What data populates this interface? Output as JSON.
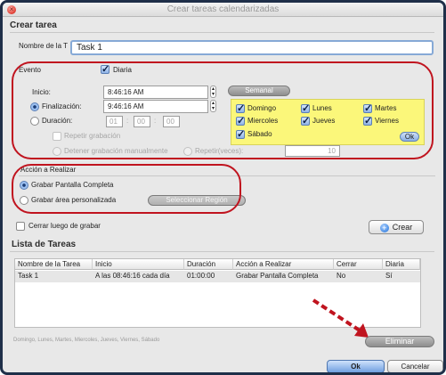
{
  "window": {
    "title": "Crear tareas calendarizadas"
  },
  "crear_tarea": {
    "section_title": "Crear tarea",
    "name_label": "Nombre de la T",
    "name_value": "Task 1"
  },
  "evento": {
    "label": "Evento",
    "diaria_label": "Diaria",
    "diaria_checked": true,
    "inicio_label": "Inicio:",
    "inicio_value": "8:46:16 AM",
    "finalizacion_label": "Finalización:",
    "finalizacion_value": "9:46:16 AM",
    "duracion_label": "Duración:",
    "duracion_values": [
      "01",
      "00",
      "00"
    ],
    "duracion_sep": ":",
    "repetir_label": "Repetir grabación",
    "detener_label": "Detener grabación manualmente",
    "repetir_veces_label": "Repetir(veces):",
    "repetir_veces_value": "10",
    "semanal_label": "Semanal",
    "days": [
      {
        "label": "Domingo",
        "checked": true
      },
      {
        "label": "Lunes",
        "checked": true
      },
      {
        "label": "Martes",
        "checked": true
      },
      {
        "label": "Miercoles",
        "checked": true
      },
      {
        "label": "Jueves",
        "checked": true
      },
      {
        "label": "Viernes",
        "checked": true
      },
      {
        "label": "Sábado",
        "checked": true
      }
    ],
    "ok_label": "Ok"
  },
  "accion": {
    "label": "Acción a Realizar",
    "options": [
      {
        "label": "Grabar Pantalla Completa",
        "selected": true
      },
      {
        "label": "Grabar área personalizada",
        "selected": false
      }
    ],
    "seleccionar_label": "Seleccionar Región"
  },
  "cerrar_label": "Cerrar luego de grabar",
  "crear_button": "Crear",
  "lista": {
    "section_title": "Lista de Tareas",
    "columns": [
      "Nombre de la Tarea",
      "Inicio",
      "Duración",
      "Acción a Realizar",
      "Cerrar",
      "Diaria"
    ],
    "rows": [
      [
        "Task 1",
        "A las 08:46:16 cada día",
        "01:00:00",
        "Grabar Pantalla Completa",
        "No",
        "Sí"
      ]
    ]
  },
  "footer_text": "Domingo, Lunes, Martes, Miercoles, Jueves, Viernes, Sábado",
  "eliminar_button": "Eliminar",
  "ok_button": "Ok",
  "cancelar_button": "Cancelar",
  "colors": {
    "highlight_ring": "#c0141f",
    "days_panel": "#fbf77a",
    "window_border": "#1f2f49"
  }
}
